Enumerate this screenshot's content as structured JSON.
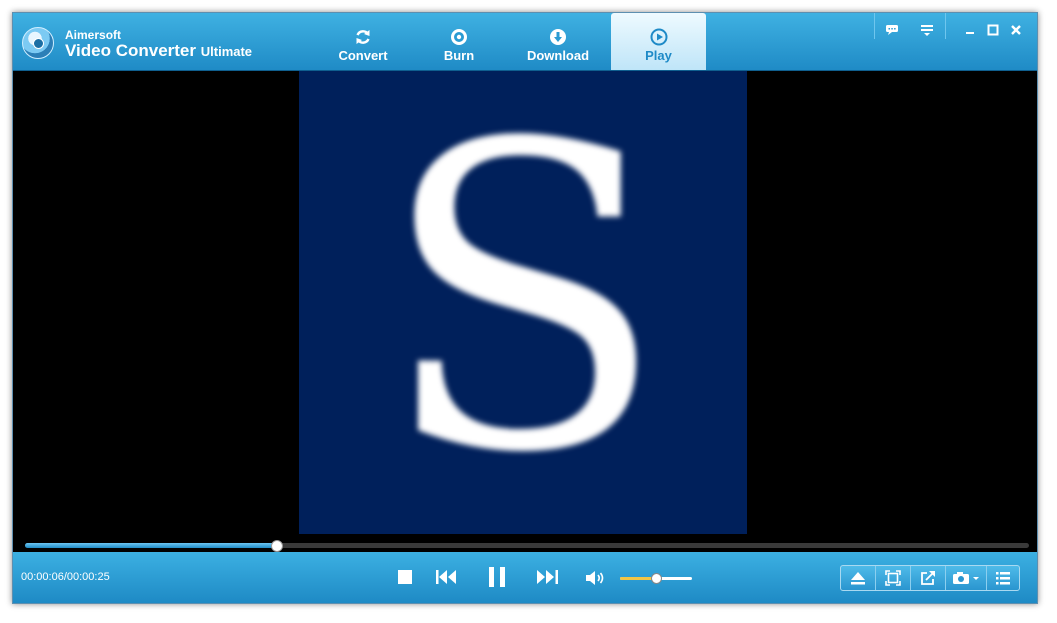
{
  "app": {
    "brand": "Aimersoft",
    "product_name": "Video Converter",
    "product_edition": "Ultimate"
  },
  "tabs": [
    {
      "label": "Convert",
      "icon": "refresh-icon",
      "active": false
    },
    {
      "label": "Burn",
      "icon": "disc-icon",
      "active": false
    },
    {
      "label": "Download",
      "icon": "download-icon",
      "active": false
    },
    {
      "label": "Play",
      "icon": "play-circle-icon",
      "active": true
    }
  ],
  "window_controls": {
    "feedback": "chat-icon",
    "menu": "menu-icon",
    "minimize": "minimize-icon",
    "maximize": "maximize-icon",
    "close": "close-icon"
  },
  "video": {
    "letter": "S",
    "background": "#00205b"
  },
  "playback": {
    "time_display": "00:00:06/00:00:25",
    "progress": 0.25,
    "volume": 0.5
  },
  "colors": {
    "accent": "#1e8ac7",
    "title_bar": "#2a9bd3",
    "volume_fill": "#f3c645"
  }
}
